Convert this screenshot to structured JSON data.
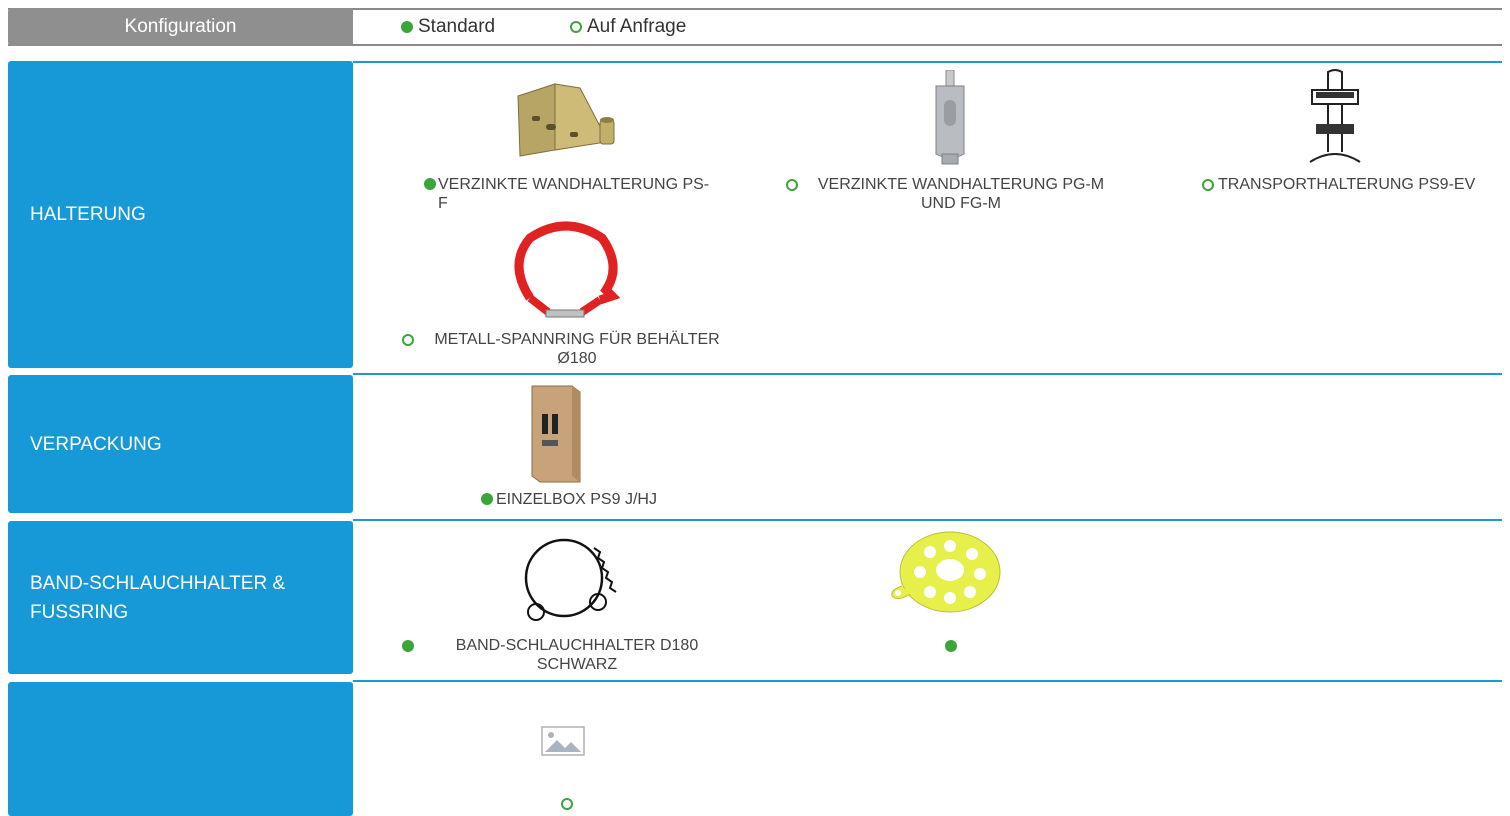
{
  "header": {
    "label": "Konfiguration",
    "legend_standard": "Standard",
    "legend_on_request": "Auf Anfrage"
  },
  "sections": {
    "halterung": {
      "title": "HALTERUNG",
      "items": [
        {
          "label": "VERZINKTE WANDHALTERUNG PS-F",
          "marker": "filled",
          "icon": "wall-bracket-image"
        },
        {
          "label": "VERZINKTE WANDHALTERUNG PG-M UND FG-M",
          "marker": "open",
          "icon": "wall-bracket-pg-image"
        },
        {
          "label": "TRANSPORTHALTERUNG PS9-EV",
          "marker": "open",
          "icon": "transport-bracket-image"
        },
        {
          "label": "METALL-SPANNRING FÜR BEHÄLTER Ø180",
          "marker": "open",
          "icon": "tension-ring-image"
        }
      ]
    },
    "verpackung": {
      "title": "VERPACKUNG",
      "items": [
        {
          "label": "EINZELBOX PS9 J/HJ",
          "marker": "filled",
          "icon": "box-image"
        }
      ]
    },
    "band": {
      "title": "BAND-SCHLAUCHHALTER & FUSSRING",
      "items": [
        {
          "label": "BAND-SCHLAUCHHALTER D180 SCHWARZ",
          "marker": "filled",
          "icon": "hose-holder-image"
        },
        {
          "label": "",
          "marker": "filled",
          "icon": "foot-ring-image"
        }
      ]
    },
    "extra": {
      "title": "",
      "items": [
        {
          "label": "",
          "marker": "open",
          "icon": "placeholder-image"
        }
      ]
    }
  },
  "colors": {
    "accent_blue": "#1799d8",
    "marker_green": "#3aa63a",
    "header_gray": "#8f8f8f"
  }
}
